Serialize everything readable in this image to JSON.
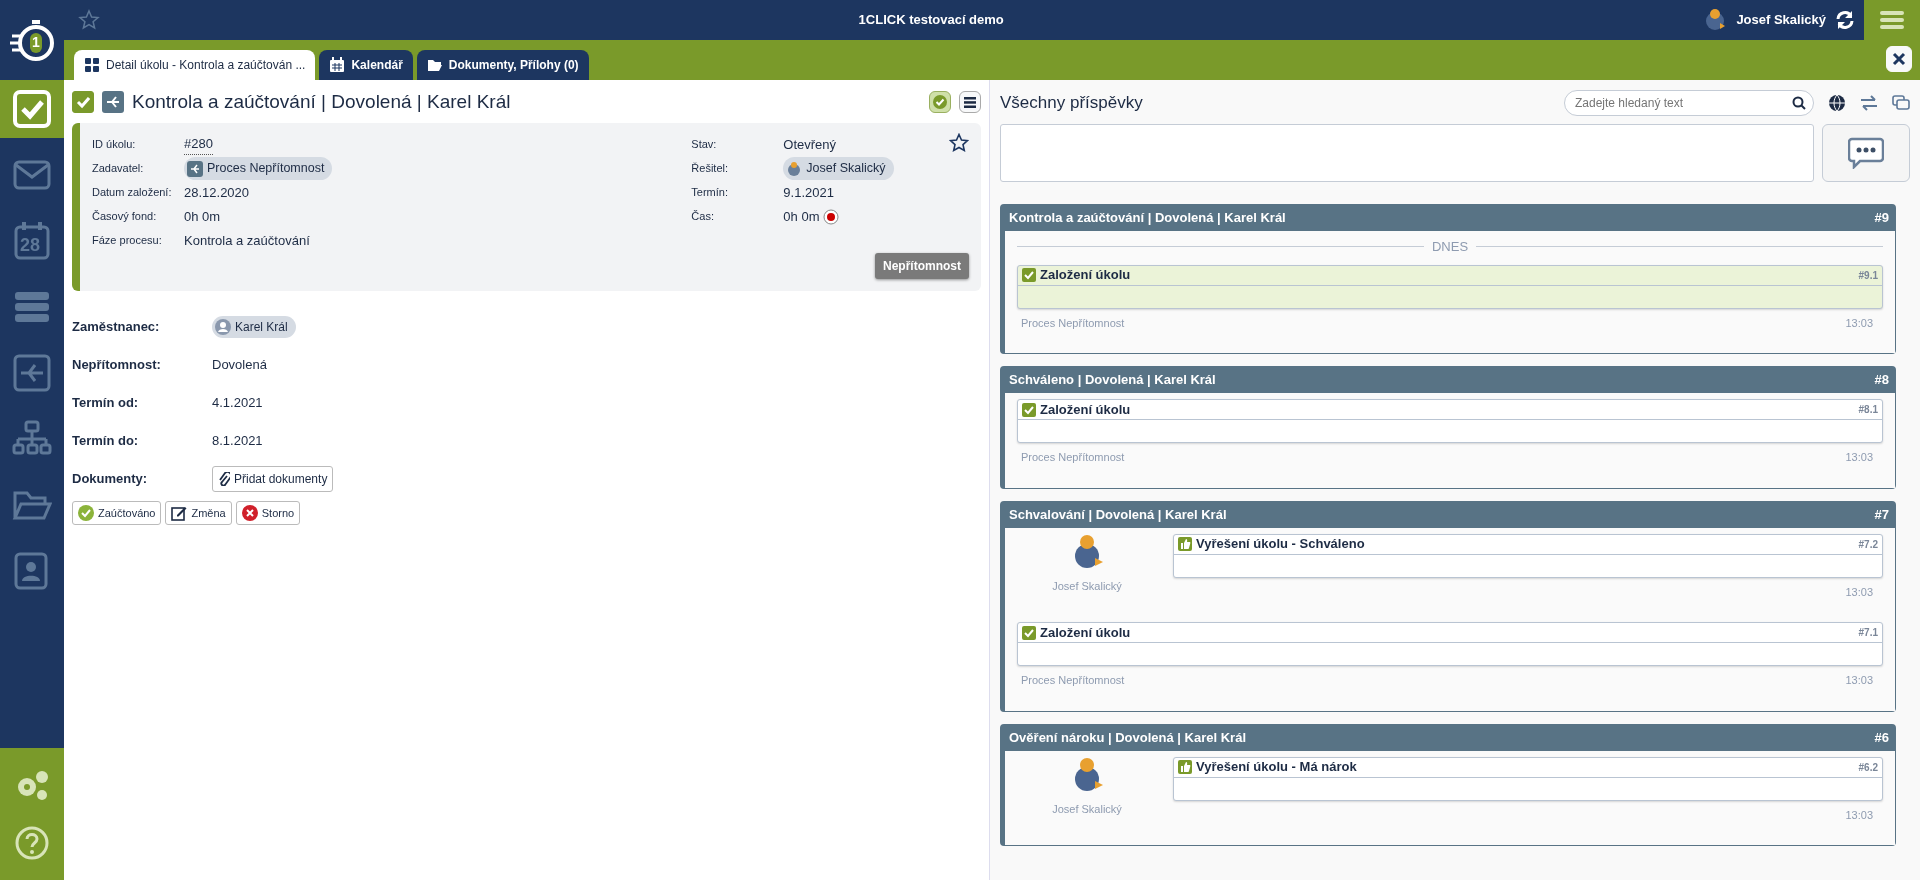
{
  "app": {
    "logo_text": "1",
    "title": "1CLICK testovací demo",
    "user": "Josef Skalický"
  },
  "sidebar": {
    "items": [
      {
        "kind": "tasks",
        "selected": true
      },
      {
        "kind": "mail",
        "selected": false
      },
      {
        "kind": "calendar",
        "selected": false,
        "icon_text": "28"
      },
      {
        "kind": "list",
        "selected": false
      },
      {
        "kind": "process",
        "selected": false
      },
      {
        "kind": "org",
        "selected": false
      },
      {
        "kind": "folder",
        "selected": false
      },
      {
        "kind": "contacts",
        "selected": false
      }
    ],
    "bottom": [
      {
        "kind": "settings"
      },
      {
        "kind": "help"
      }
    ]
  },
  "tabs": [
    {
      "label": "Detail úkolu - Kontrola a zaúčtován ...",
      "kind": "grid",
      "selected": true
    },
    {
      "label": "Kalendář",
      "kind": "calendar",
      "selected": false
    },
    {
      "label": "Dokumenty, Přílohy (0)",
      "kind": "folder",
      "selected": false
    }
  ],
  "task": {
    "title": "Kontrola a zaúčtování | Dovolená | Karel Král",
    "done": true,
    "starred": false,
    "category": "Nepřítomnost",
    "info_left": [
      {
        "label": "ID úkolu:",
        "value": "#280",
        "kind": "link"
      },
      {
        "label": "Zadavatel:",
        "value": "Proces Nepřítomnost",
        "kind": "chip-process"
      },
      {
        "label": "Datum založení:",
        "value": "28.12.2020",
        "kind": "text"
      },
      {
        "label": "Časový fond:",
        "value": "0h 0m",
        "kind": "text"
      },
      {
        "label": "Fáze procesu:",
        "value": "Kontrola a zaúčtování",
        "kind": "text"
      }
    ],
    "info_right": [
      {
        "label": "Stav:",
        "value": "Otevřený",
        "kind": "text"
      },
      {
        "label": "Řešitel:",
        "value": "Josef Skalický",
        "kind": "chip-user"
      },
      {
        "label": "Termín:",
        "value": "9.1.2021",
        "kind": "text"
      },
      {
        "label": "Čas:",
        "value": "0h 0m",
        "kind": "timer"
      }
    ]
  },
  "form": [
    {
      "label": "Zaměstnanec:",
      "value": "Karel Král",
      "kind": "chip-person"
    },
    {
      "label": "Nepřítomnost:",
      "value": "Dovolená",
      "kind": "text"
    },
    {
      "label": "Termín od:",
      "value": "4.1.2021",
      "kind": "text"
    },
    {
      "label": "Termín do:",
      "value": "8.1.2021",
      "kind": "text"
    },
    {
      "label": "Dokumenty:",
      "value": "Přidat dokumenty",
      "kind": "button"
    }
  ],
  "actions": [
    {
      "label": "Zaúčtováno",
      "kind": "approve"
    },
    {
      "label": "Změna",
      "kind": "edit"
    },
    {
      "label": "Storno",
      "kind": "cancel"
    }
  ],
  "feed": {
    "title": "Všechny příspěvky",
    "search_placeholder": "Zadejte hledaný text",
    "threads": [
      {
        "title": "Kontrola a zaúčtování | Dovolená | Karel Král",
        "number": "#9",
        "day": "DNES",
        "posts": [
          {
            "kind": "created",
            "title": "Založení úkolu",
            "number": "#9.1",
            "highlighted": true,
            "author": "Proces Nepřítomnost",
            "time": "13:03"
          }
        ]
      },
      {
        "title": "Schváleno | Dovolená | Karel Král",
        "number": "#8",
        "posts": [
          {
            "kind": "created",
            "title": "Založení úkolu",
            "number": "#8.1",
            "highlighted": false,
            "author": "Proces Nepřítomnost",
            "time": "13:03"
          }
        ]
      },
      {
        "title": "Schvalování | Dovolená | Karel Král",
        "number": "#7",
        "posts": [
          {
            "kind": "resolved",
            "title": "Vyřešení úkolu - Schváleno",
            "number": "#7.2",
            "highlighted": false,
            "author": "Josef Skalický",
            "time": "13:03"
          },
          {
            "kind": "created",
            "title": "Založení úkolu",
            "number": "#7.1",
            "highlighted": false,
            "author": "Proces Nepřítomnost",
            "time": "13:03"
          }
        ]
      },
      {
        "title": "Ověření nároku | Dovolená | Karel Král",
        "number": "#6",
        "posts": [
          {
            "kind": "resolved",
            "title": "Vyřešení úkolu - Má nárok",
            "number": "#6.2",
            "highlighted": false,
            "author": "Josef Skalický",
            "time": "13:03"
          }
        ]
      }
    ]
  }
}
